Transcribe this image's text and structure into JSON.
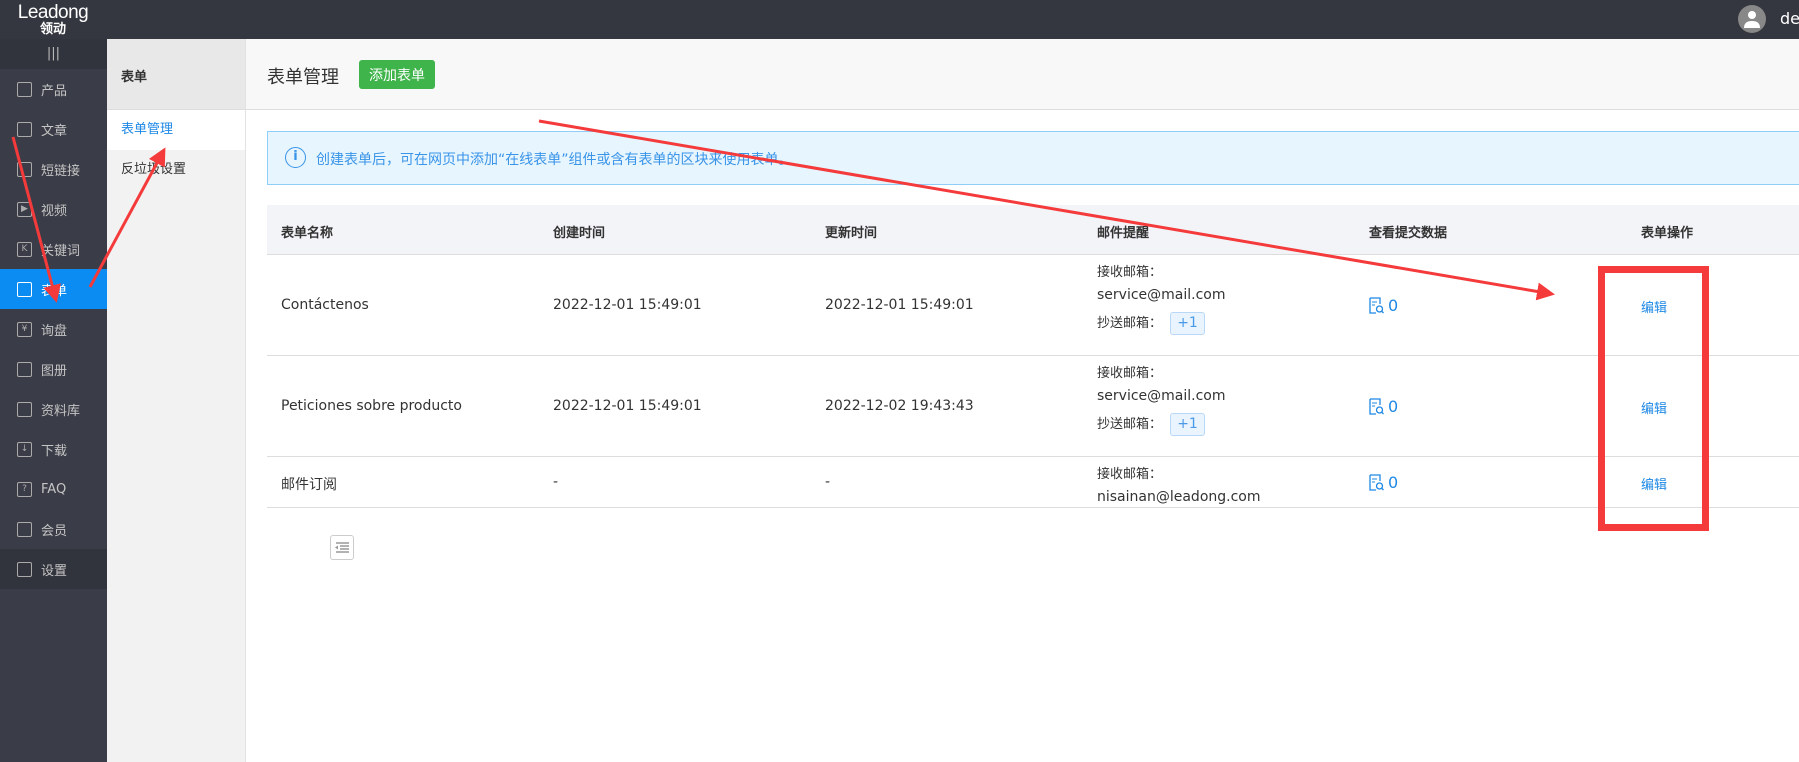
{
  "topbar": {
    "logo_en": "Leadong",
    "logo_cn": "领动",
    "user": "de"
  },
  "sidebar": {
    "menu_icon": "|||",
    "items": [
      {
        "label": "产品",
        "icon": "grid-icon"
      },
      {
        "label": "文章",
        "icon": "document-icon"
      },
      {
        "label": "短链接",
        "icon": "link-icon"
      },
      {
        "label": "视频",
        "icon": "play-icon"
      },
      {
        "label": "关键词",
        "icon": "k-icon"
      },
      {
        "label": "表单",
        "icon": "clipboard-icon",
        "active": true
      },
      {
        "label": "询盘",
        "icon": "yen-chat-icon"
      },
      {
        "label": "图册",
        "icon": "album-icon"
      },
      {
        "label": "资料库",
        "icon": "library-icon"
      },
      {
        "label": "下载",
        "icon": "download-icon"
      },
      {
        "label": "FAQ",
        "icon": "question-icon"
      },
      {
        "label": "会员",
        "icon": "crown-icon"
      },
      {
        "label": "设置",
        "icon": "gear-icon"
      }
    ]
  },
  "subnav": {
    "title": "表单",
    "items": [
      "表单管理",
      "反垃圾设置"
    ]
  },
  "main": {
    "title": "表单管理",
    "add_button": "添加表单",
    "alert": "创建表单后，可在网页中添加“在线表单”组件或含有表单的区块来使用表单。",
    "columns": [
      "表单名称",
      "创建时间",
      "更新时间",
      "邮件提醒",
      "查看提交数据",
      "表单操作"
    ],
    "recv_label": "接收邮箱：",
    "cc_label": "抄送邮箱：",
    "rows": [
      {
        "name": "Contáctenos",
        "created": "2022-12-01 15:49:01",
        "updated": "2022-12-01 15:49:01",
        "recv": "service@mail.com",
        "cc": "+1",
        "count": "0",
        "action": "编辑"
      },
      {
        "name": "Peticiones sobre producto",
        "created": "2022-12-01 15:49:01",
        "updated": "2022-12-02 19:43:43",
        "recv": "service@mail.com",
        "cc": "+1",
        "count": "0",
        "action": "编辑"
      },
      {
        "name": "邮件订阅",
        "created": "-",
        "updated": "-",
        "recv": "nisainan@leadong.com",
        "count": "0",
        "action": "编辑"
      }
    ]
  },
  "colors": {
    "accent": "#0a8cf2",
    "green": "#3fb44b",
    "annotation": "#f43a3a"
  }
}
